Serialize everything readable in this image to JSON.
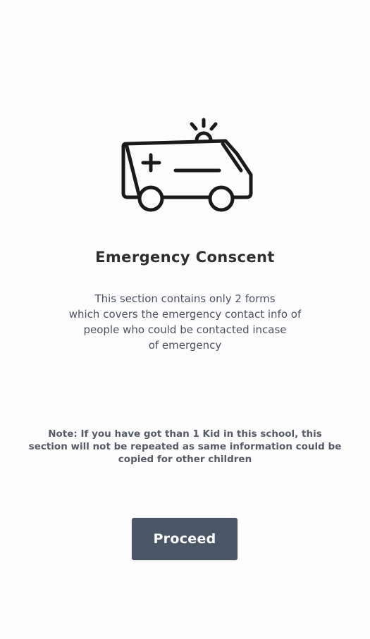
{
  "page": {
    "icon": "ambulance-icon",
    "title": "Emergency Conscent",
    "description_lines": [
      "This section contains only 2 forms",
      "which covers the emergency contact info of",
      "people who could be contacted incase",
      "of emergency"
    ],
    "note_lines": [
      "Note: If you have got than 1 Kid in this school, this",
      "section will not be repeated as same information could be",
      "copied for other children"
    ],
    "proceed_label": "Proceed"
  },
  "colors": {
    "background": "#fdfdfd",
    "button": "#4a5566",
    "button_text": "#ffffff",
    "title": "#2f2f2f",
    "body_text": "#4a5260"
  }
}
